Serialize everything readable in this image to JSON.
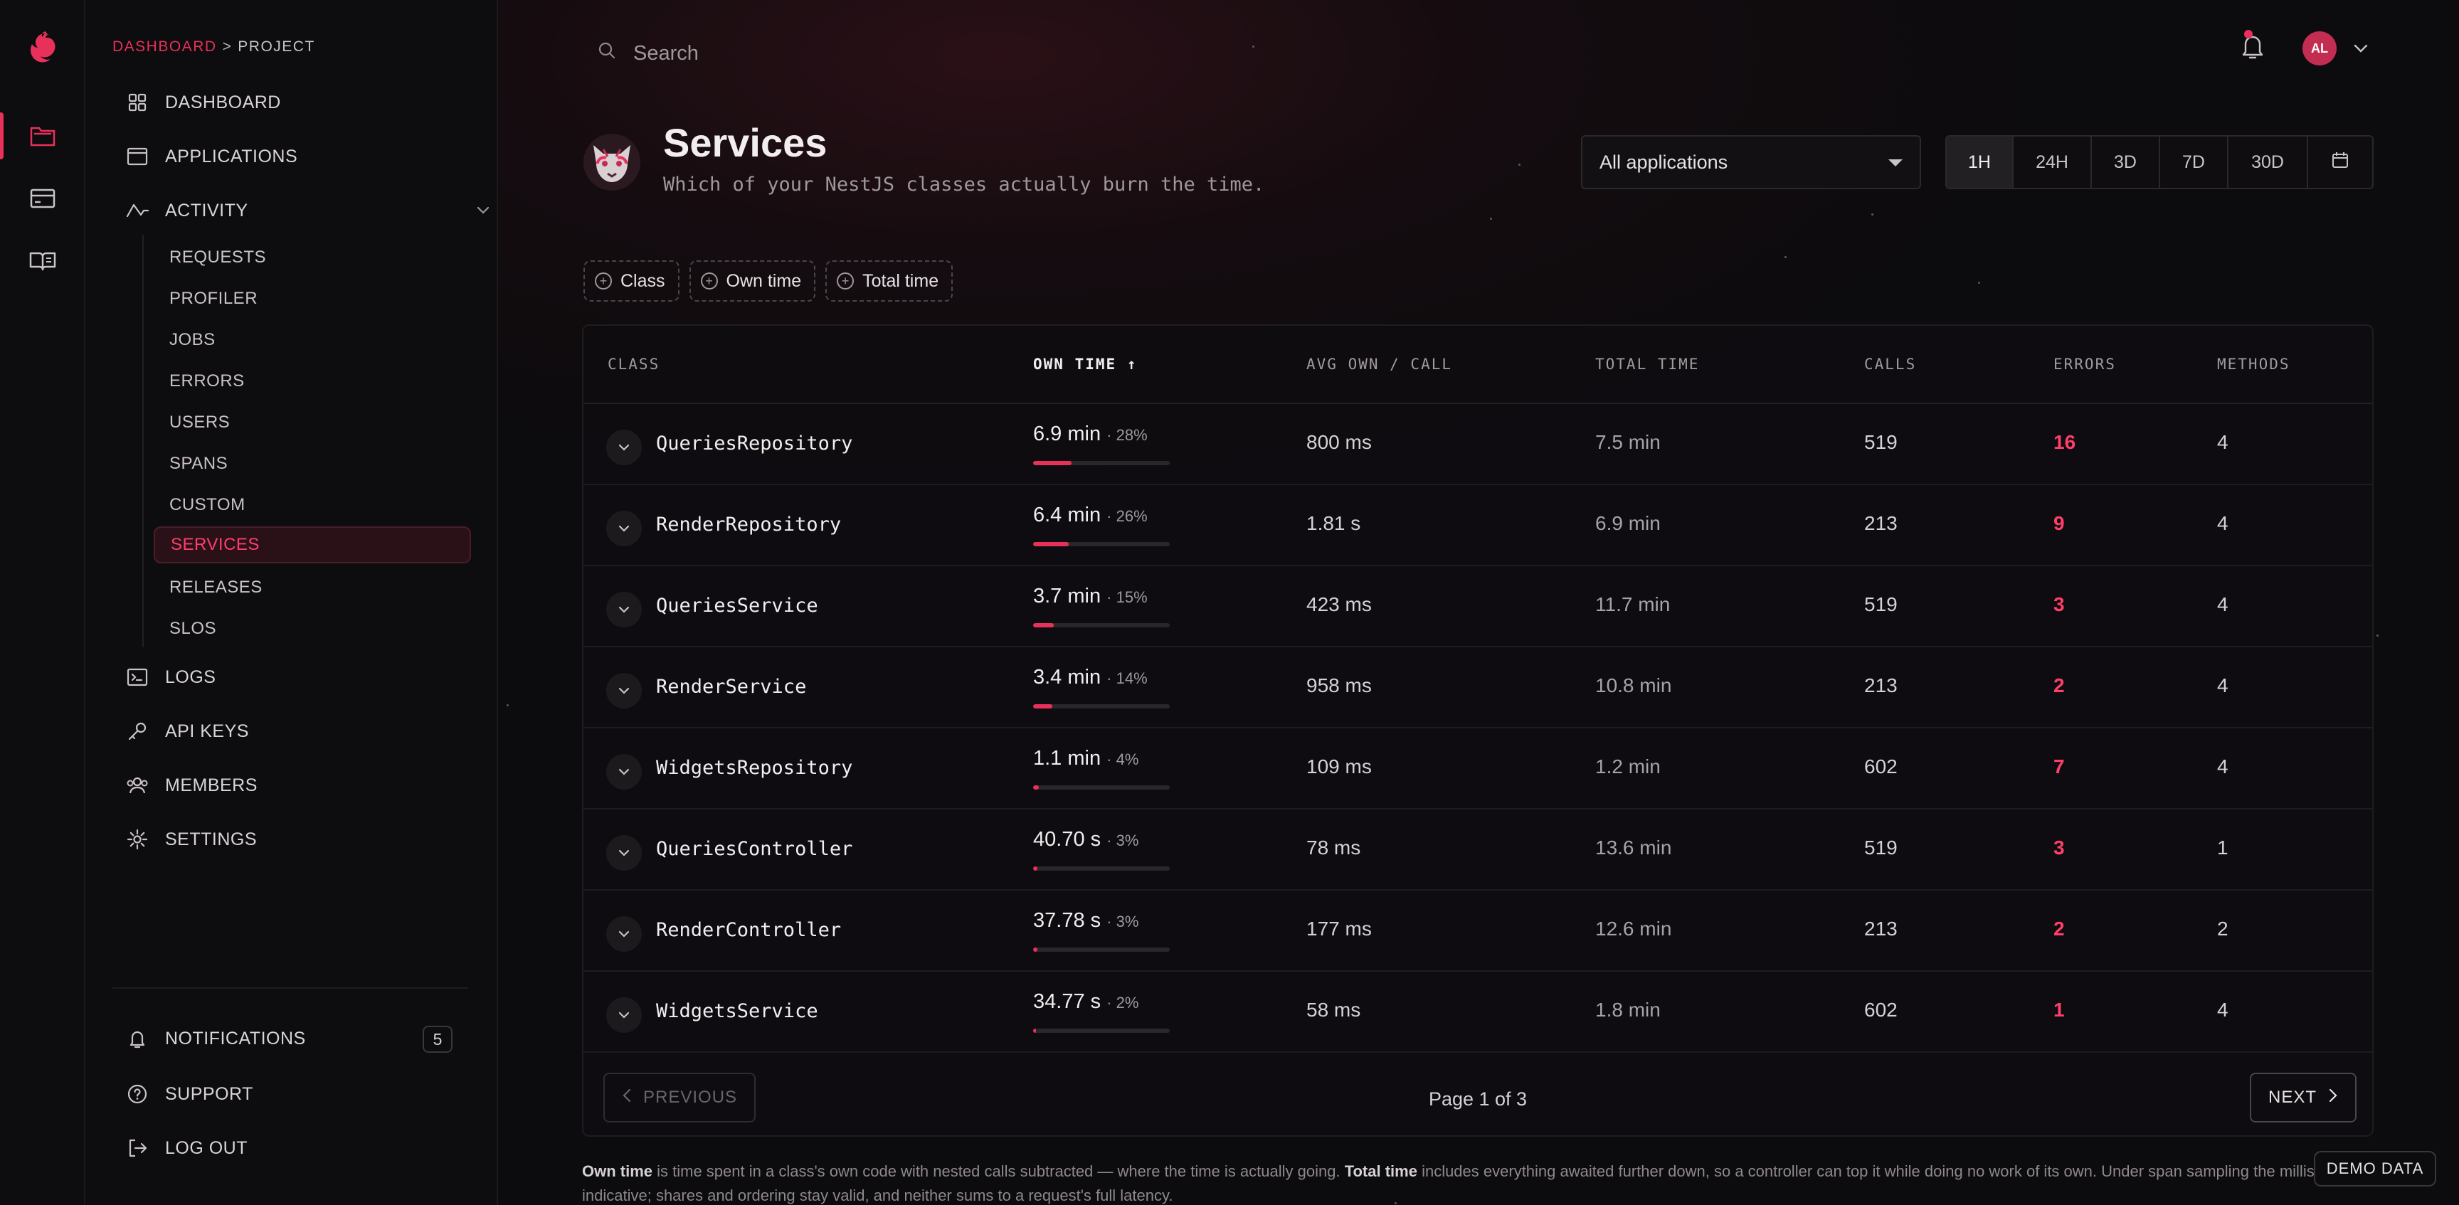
{
  "breadcrumb": {
    "root": "DASHBOARD",
    "separator": ">",
    "current": "PROJECT"
  },
  "sidebar": {
    "items": [
      {
        "label": "DASHBOARD",
        "icon": "grid-icon"
      },
      {
        "label": "APPLICATIONS",
        "icon": "window-icon"
      },
      {
        "label": "ACTIVITY",
        "icon": "activity-icon",
        "expanded": true
      }
    ],
    "activity_children": [
      "REQUESTS",
      "PROFILER",
      "JOBS",
      "ERRORS",
      "USERS",
      "SPANS",
      "CUSTOM",
      "SERVICES",
      "RELEASES",
      "SLOS"
    ],
    "active_child": "SERVICES",
    "items_after": [
      {
        "label": "LOGS",
        "icon": "terminal-icon"
      },
      {
        "label": "API KEYS",
        "icon": "key-icon"
      },
      {
        "label": "MEMBERS",
        "icon": "users-icon"
      },
      {
        "label": "SETTINGS",
        "icon": "gear-icon"
      }
    ],
    "bottom": [
      {
        "label": "NOTIFICATIONS",
        "icon": "bell-icon",
        "count": "5"
      },
      {
        "label": "SUPPORT",
        "icon": "help-icon"
      },
      {
        "label": "LOG OUT",
        "icon": "logout-icon"
      }
    ]
  },
  "header": {
    "search_placeholder": "Search",
    "avatar_initials": "AL"
  },
  "page": {
    "title": "Services",
    "subtitle": "Which of your NestJS classes actually burn the time.",
    "app_filter": "All applications",
    "time_ranges": [
      "1H",
      "24H",
      "3D",
      "7D",
      "30D"
    ],
    "active_range": "1H",
    "filter_chips": [
      "Class",
      "Own time",
      "Total time"
    ]
  },
  "table": {
    "columns": [
      "CLASS",
      "OWN TIME",
      "AVG OWN / CALL",
      "TOTAL TIME",
      "CALLS",
      "ERRORS",
      "METHODS"
    ],
    "sort_indicator": "↑",
    "rows": [
      {
        "class": "QueriesRepository",
        "own": "6.9 min",
        "share": "· 28%",
        "share_value": 28,
        "avg": "800 ms",
        "total": "7.5 min",
        "calls": "519",
        "errors": "16",
        "methods": "4"
      },
      {
        "class": "RenderRepository",
        "own": "6.4 min",
        "share": "· 26%",
        "share_value": 26,
        "avg": "1.81 s",
        "total": "6.9 min",
        "calls": "213",
        "errors": "9",
        "methods": "4"
      },
      {
        "class": "QueriesService",
        "own": "3.7 min",
        "share": "· 15%",
        "share_value": 15,
        "avg": "423 ms",
        "total": "11.7 min",
        "calls": "519",
        "errors": "3",
        "methods": "4"
      },
      {
        "class": "RenderService",
        "own": "3.4 min",
        "share": "· 14%",
        "share_value": 14,
        "avg": "958 ms",
        "total": "10.8 min",
        "calls": "213",
        "errors": "2",
        "methods": "4"
      },
      {
        "class": "WidgetsRepository",
        "own": "1.1 min",
        "share": "· 4%",
        "share_value": 4,
        "avg": "109 ms",
        "total": "1.2 min",
        "calls": "602",
        "errors": "7",
        "methods": "4"
      },
      {
        "class": "QueriesController",
        "own": "40.70 s",
        "share": "· 3%",
        "share_value": 3,
        "avg": "78 ms",
        "total": "13.6 min",
        "calls": "519",
        "errors": "3",
        "methods": "1"
      },
      {
        "class": "RenderController",
        "own": "37.78 s",
        "share": "· 3%",
        "share_value": 3,
        "avg": "177 ms",
        "total": "12.6 min",
        "calls": "213",
        "errors": "2",
        "methods": "2"
      },
      {
        "class": "WidgetsService",
        "own": "34.77 s",
        "share": "· 2%",
        "share_value": 2,
        "avg": "58 ms",
        "total": "1.8 min",
        "calls": "602",
        "errors": "1",
        "methods": "4"
      }
    ],
    "pagination": {
      "prev": "PREVIOUS",
      "next": "NEXT",
      "info": "Page 1 of 3"
    }
  },
  "footnote": {
    "own_term": "Own time",
    "own_text": " is time spent in a class's own code with nested calls subtracted — where the time is actually going. ",
    "total_term": "Total time",
    "total_text": " includes everything awaited further down, so a controller can top it while doing no work of its own. Under span sampling the milliseconds are indicative; shares and ordering stay valid, and neither sums to a request's full latency."
  },
  "demo_badge": "DEMO DATA",
  "colors": {
    "accent": "#e8315a",
    "error_text": "#ff3f6a",
    "background": "#0c0b0d"
  }
}
